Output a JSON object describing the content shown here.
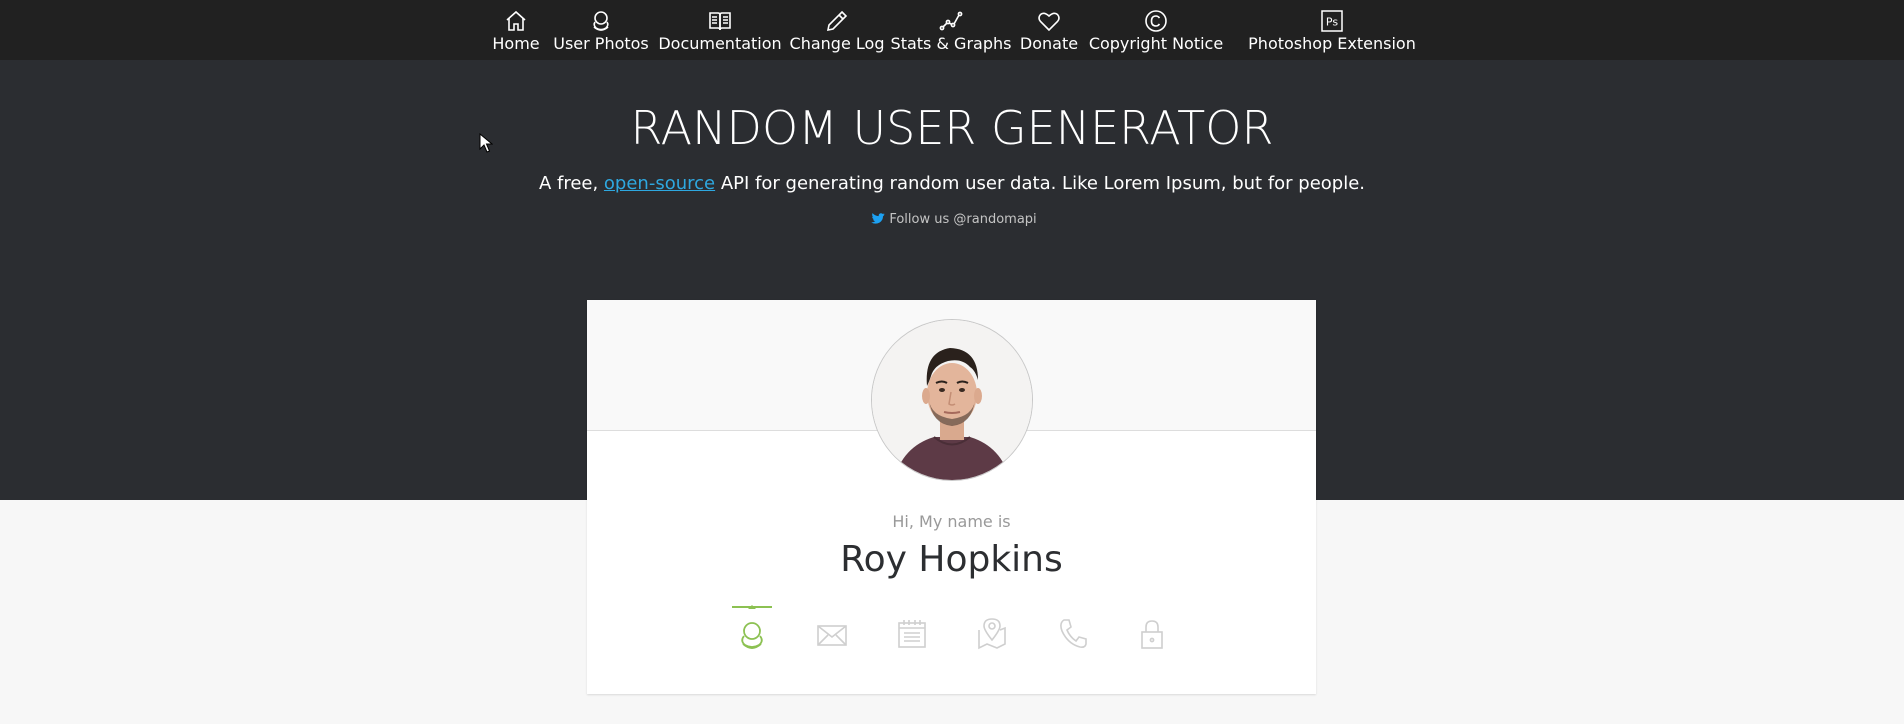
{
  "nav": {
    "items": [
      {
        "label": "Home",
        "icon": "home-icon"
      },
      {
        "label": "User Photos",
        "icon": "user-photos-icon"
      },
      {
        "label": "Documentation",
        "icon": "book-icon"
      },
      {
        "label": "Change Log",
        "icon": "pencil-icon"
      },
      {
        "label": "Stats & Graphs",
        "icon": "stats-icon"
      },
      {
        "label": "Donate",
        "icon": "heart-icon"
      },
      {
        "label": "Copyright Notice",
        "icon": "copyright-icon"
      },
      {
        "label": "Photoshop Extension",
        "icon": "photoshop-icon",
        "icon_text": "Ps"
      }
    ]
  },
  "hero": {
    "title": "RANDOM USER GENERATOR",
    "tagline_prefix": "A free, ",
    "tagline_link": "open-source",
    "tagline_suffix": " API for generating random user data. Like Lorem Ipsum, but for people.",
    "follow": "Follow us @randomapi"
  },
  "user": {
    "greeting": "Hi, My name is",
    "name": "Roy Hopkins"
  },
  "tabs": [
    {
      "icon": "user-icon",
      "active": true
    },
    {
      "icon": "email-icon",
      "active": false
    },
    {
      "icon": "calendar-icon",
      "active": false
    },
    {
      "icon": "map-icon",
      "active": false
    },
    {
      "icon": "phone-icon",
      "active": false
    },
    {
      "icon": "lock-icon",
      "active": false
    }
  ],
  "colors": {
    "nav_bg": "#212121",
    "hero_bg": "#2b2d31",
    "accent": "#8cc152",
    "link": "#2ea8e0",
    "twitter": "#1da1f2"
  }
}
